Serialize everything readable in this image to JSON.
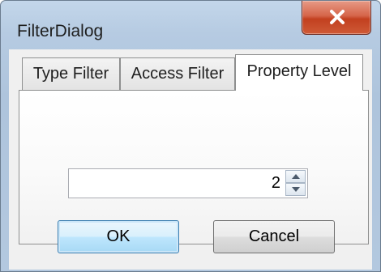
{
  "window": {
    "title": "FilterDialog"
  },
  "tabs": [
    {
      "label": "Type Filter",
      "active": false
    },
    {
      "label": "Access Filter",
      "active": false
    },
    {
      "label": "Property Level",
      "active": true
    }
  ],
  "level_spinner": {
    "value": "2"
  },
  "buttons": {
    "ok_label": "OK",
    "cancel_label": "Cancel"
  },
  "colors": {
    "frame": "#b6cbe2",
    "close_button": "#c7452a",
    "client": "#f0f0f0",
    "default_button_border": "#3c7fb1"
  },
  "icons": {
    "close": "close-icon",
    "spin_up": "caret-up-icon",
    "spin_down": "caret-down-icon"
  }
}
